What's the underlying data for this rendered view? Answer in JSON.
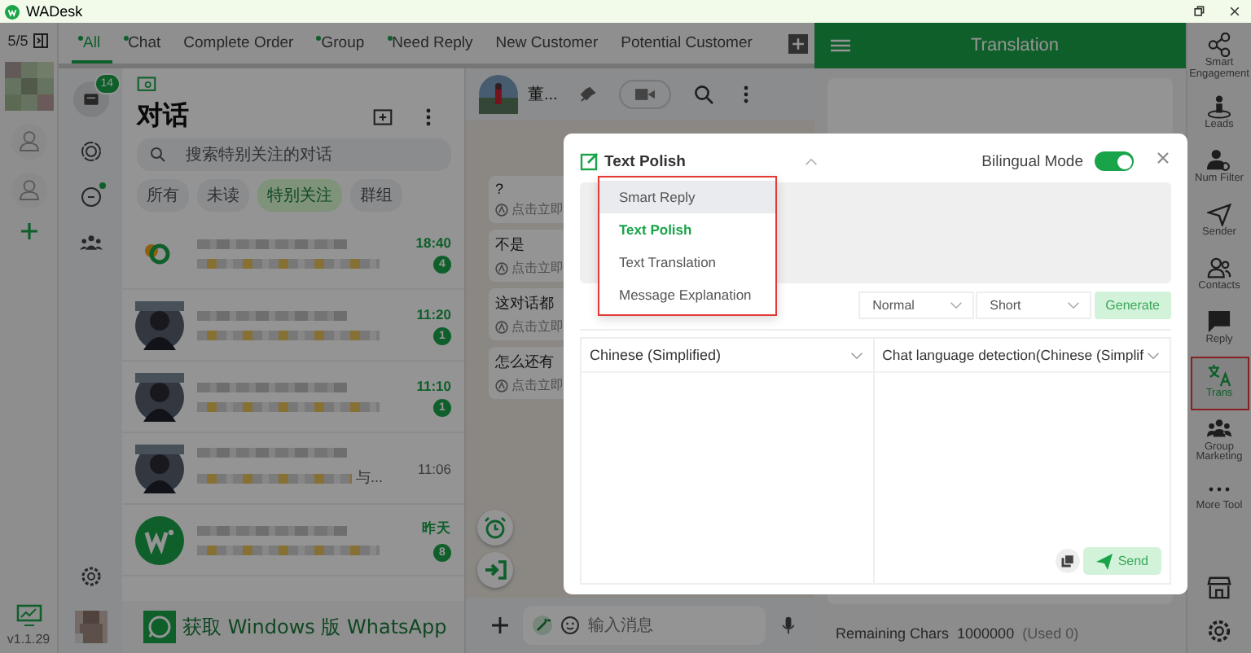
{
  "window": {
    "title": "WADesk"
  },
  "account_rail": {
    "counter": "5/5",
    "accounts": [
      {
        "kind": "picture"
      },
      {
        "kind": "placeholder"
      },
      {
        "kind": "placeholder"
      }
    ],
    "version": "v1.1.29"
  },
  "tabs": [
    {
      "label": "All",
      "dot": true,
      "selected": true
    },
    {
      "label": "Chat",
      "dot": true,
      "selected": false
    },
    {
      "label": "Complete Order",
      "dot": false,
      "selected": false
    },
    {
      "label": "Group",
      "dot": true,
      "selected": false
    },
    {
      "label": "Need Reply",
      "dot": true,
      "selected": false
    },
    {
      "label": "New Customer",
      "dot": false,
      "selected": false
    },
    {
      "label": "Potential Customer",
      "dot": false,
      "selected": false
    }
  ],
  "wa_rail": {
    "chats_badge": "14",
    "channels_dot": true
  },
  "chat_list": {
    "title": "对话",
    "search": {
      "placeholder": "搜索特别关注的对话"
    },
    "filters": [
      {
        "label": "所有",
        "selected": false
      },
      {
        "label": "未读",
        "selected": false
      },
      {
        "label": "特别关注",
        "selected": true
      },
      {
        "label": "群组",
        "selected": false
      }
    ],
    "rows": [
      {
        "kind": "logo",
        "time": "18:40",
        "unread": "4"
      },
      {
        "kind": "picture",
        "time": "11:20",
        "unread": "1"
      },
      {
        "kind": "picture",
        "time": "11:10",
        "unread": "1"
      },
      {
        "kind": "picture",
        "time": "11:06",
        "preview_end": "与..."
      },
      {
        "kind": "w-logo",
        "time": "昨天",
        "unread": "8"
      }
    ],
    "banner": "获取 Windows 版 WhatsApp"
  },
  "chat": {
    "name": "董...",
    "messages": [
      {
        "text": "?",
        "sub": "点击立即"
      },
      {
        "text": "不是",
        "sub": "点击立即"
      },
      {
        "text": "这对话都",
        "sub": "点击立即"
      },
      {
        "text": "怎么还有",
        "sub": "点击立即"
      }
    ],
    "input": {
      "placeholder": "输入消息"
    }
  },
  "translation": {
    "title": "Translation",
    "remaining_label": "Remaining Chars",
    "remaining": "1000000",
    "used": "(Used 0)"
  },
  "tools": [
    {
      "label": "Smart Engagement",
      "kind": "share",
      "selected": false
    },
    {
      "label": "Leads",
      "kind": "leads",
      "selected": false
    },
    {
      "label": "Num Filter",
      "kind": "filter",
      "selected": false
    },
    {
      "label": "Sender",
      "kind": "sender",
      "selected": false
    },
    {
      "label": "Contacts",
      "kind": "contacts",
      "selected": false
    },
    {
      "label": "Reply",
      "kind": "reply",
      "selected": false
    },
    {
      "label": "Trans",
      "kind": "trans",
      "selected": true
    },
    {
      "label": "Group Marketing",
      "kind": "group",
      "selected": false
    },
    {
      "label": "More Tool",
      "kind": "more",
      "selected": false
    }
  ],
  "modal": {
    "mode": "Text Polish",
    "menu": [
      {
        "label": "Smart Reply",
        "hovered": true,
        "selected": false
      },
      {
        "label": "Text Polish",
        "hovered": false,
        "selected": true
      },
      {
        "label": "Text Translation",
        "hovered": false,
        "selected": false
      },
      {
        "label": "Message Explanation",
        "hovered": false,
        "selected": false
      }
    ],
    "bilingual_mode": {
      "label": "Bilingual Mode",
      "on": true
    },
    "tone": "Normal",
    "length": "Short",
    "generate": "Generate",
    "source_language": "Chinese (Simplified)",
    "target_language": "Chat language detection(Chinese (Simplif",
    "send": "Send"
  }
}
